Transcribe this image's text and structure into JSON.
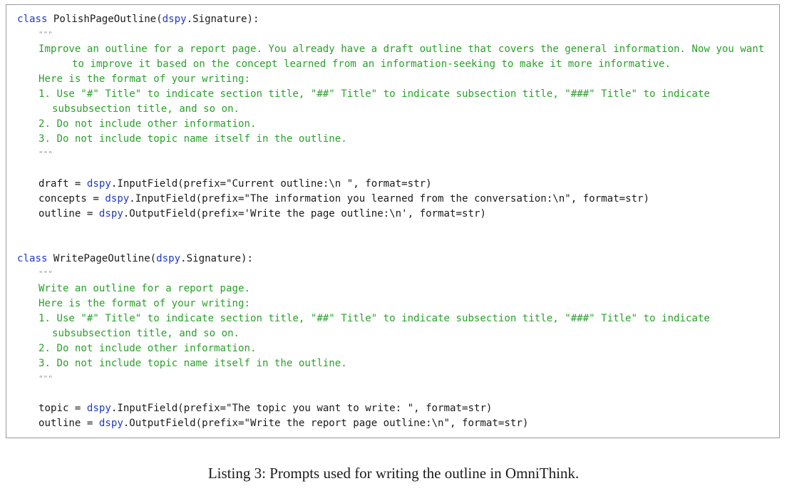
{
  "listing": {
    "block1": {
      "class_kw": "class",
      "class_name": " PolishPageOutline(",
      "base_mod": "dspy",
      "base_rest": ".Signature):",
      "quote_open": "\"\"\"",
      "doc1": "Improve an outline for a report page. You already have a draft outline that covers the general information. Now you want",
      "doc2": "to improve it based on the concept learned from an information-seeking to make it more informative.",
      "doc3": "Here is the format of your writing:",
      "doc4": "1. Use \"#\" Title\" to indicate section title, \"##\" Title\" to indicate subsection title, \"###\" Title\" to indicate",
      "doc5": "subsubsection title, and so on.",
      "doc6": "2. Do not include other information.",
      "doc7": "3. Do not include topic name itself in the outline.",
      "quote_close": "\"\"\"",
      "f1_pre": "draft = ",
      "f1_mod": "dspy",
      "f1_rest": ".InputField(prefix=\"Current outline:\\n \", format=str)",
      "f2_pre": "concepts = ",
      "f2_mod": "dspy",
      "f2_rest": ".InputField(prefix=\"The information you learned from the conversation:\\n\", format=str)",
      "f3_pre": "outline = ",
      "f3_mod": "dspy",
      "f3_rest": ".OutputField(prefix='Write the page outline:\\n', format=str)"
    },
    "block2": {
      "class_kw": "class",
      "class_name": " WritePageOutline(",
      "base_mod": "dspy",
      "base_rest": ".Signature):",
      "quote_open": "\"\"\"",
      "doc1": "Write an outline for a report page.",
      "doc2": "Here is the format of your writing:",
      "doc3": "1. Use \"#\" Title\" to indicate section title, \"##\" Title\" to indicate subsection title, \"###\" Title\" to indicate",
      "doc4": "subsubsection title, and so on.",
      "doc5": "2. Do not include other information.",
      "doc6": "3. Do not include topic name itself in the outline.",
      "quote_close": "\"\"\"",
      "f1_pre": "topic = ",
      "f1_mod": "dspy",
      "f1_rest": ".InputField(prefix=\"The topic you want to write: \", format=str)",
      "f2_pre": "outline = ",
      "f2_mod": "dspy",
      "f2_rest": ".OutputField(prefix=\"Write the report page outline:\\n\", format=str)"
    }
  },
  "caption": "Listing 3: Prompts used for writing the outline in OmniThink.",
  "colors": {
    "keyword": "#1f3bbf",
    "docstring": "#2aa12a",
    "text": "#1a1a1a",
    "border": "#9a9a9a"
  }
}
